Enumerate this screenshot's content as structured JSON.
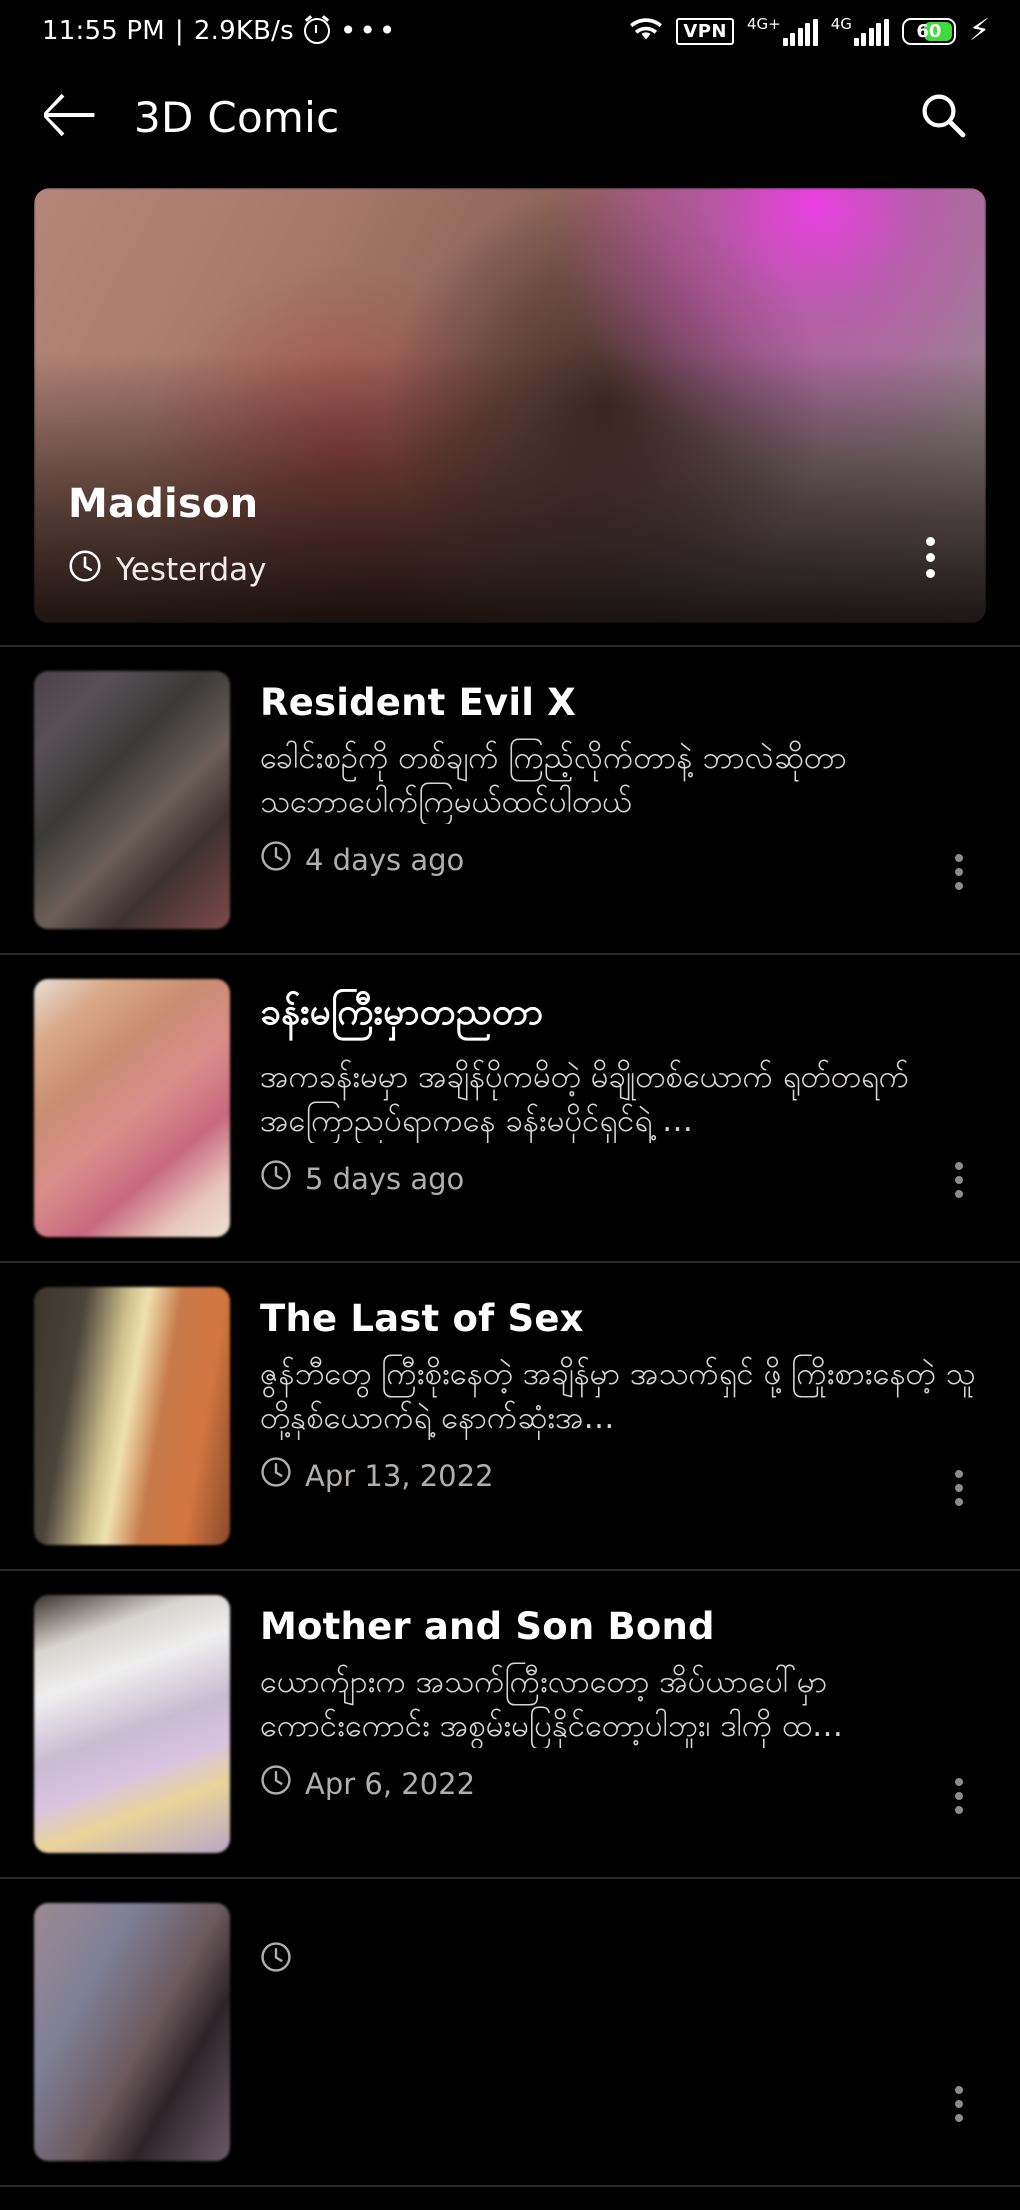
{
  "statusbar": {
    "time": "11:55 PM",
    "separator": "|",
    "netspeed": "2.9KB/s",
    "alarm_icon": "alarm-clock-icon",
    "overflow_icon": "more-dots-icon",
    "wifi_icon": "wifi-icon",
    "vpn_label": "VPN",
    "sim1_label": "4G+",
    "sim2_label": "4G",
    "battery_percent": "60",
    "charging_icon": "lightning-bolt-icon",
    "battery_color": "#3ddc3d"
  },
  "appbar": {
    "back_icon": "back-arrow-icon",
    "title": "3D Comic",
    "search_icon": "search-icon"
  },
  "featured": {
    "title": "Madison",
    "date": "Yesterday",
    "clock_icon": "clock-icon",
    "more_icon": "overflow-menu-icon"
  },
  "list": [
    {
      "title": "Resident Evil X",
      "description": "ခေါင်းစဉ်ကို တစ်ချက် ကြည့်လိုက်တာနဲ့ ဘာလဲဆိုတာ သဘောပေါက်ကြမယ်ထင်ပါတယ်",
      "date": "4 days ago",
      "clock_icon": "clock-icon",
      "more_icon": "overflow-menu-icon",
      "thumb_gradient": "linear-gradient(135deg,#4a4248 0%,#575055 18%,#3a3a38 38%,#6b5f58 58%,#3d322e 74%,#7d4a4a 100%)"
    },
    {
      "title": "ခန်းမကြီးမှာတညတာ",
      "description": "အကခန်းမမှာ အချိန်ပိုကမိတဲ့ မိချိုတစ်ယောက် ရုတ်တရက် အကြောညပ်ရာကနေ ခန်းမပိုင်ရှင်ရဲ့ …",
      "date": "5 days ago",
      "clock_icon": "clock-icon",
      "more_icon": "overflow-menu-icon",
      "thumb_gradient": "linear-gradient(140deg,#e8ded6 0%,#d9a98a 16%,#c98d72 34%,#d98e8a 52%,#c9697f 70%,#e8c6bd 86%,#efe0d6 100%)"
    },
    {
      "title": "The Last of Sex",
      "description": "ဇွန်ဘီတွေ ကြီးစိုးနေတဲ့ အချိန်မှာ အသက်ရှင် ဖို့ ကြိုးစားနေတဲ့ သူတို့နှစ်ယောက်ရဲ့ နောက်ဆုံးအ…",
      "date": "Apr 13, 2022",
      "clock_icon": "clock-icon",
      "more_icon": "overflow-menu-icon",
      "thumb_gradient": "linear-gradient(100deg,#3a342e 0%,#4a443a 22%,#cfc08d 40%,#efe1b0 48%,#c87a4a 62%,#d2763f 80%,#8a4a2c 100%)"
    },
    {
      "title": "Mother and Son Bond",
      "description": "ယောက်ျားက အသက်ကြီးလာတော့ အိပ်ယာပေါ်မှာ ကောင်းကောင်း အစွမ်းမပြနိုင်တော့ပါဘူး၊ ဒါကို ထ…",
      "date": "Apr 6, 2022",
      "clock_icon": "clock-icon",
      "more_icon": "overflow-menu-icon",
      "thumb_gradient": "linear-gradient(160deg,#3a322e 0%,#d8d4d0 18%,#efefef 32%,#c8bcd0 52%,#d9c4e0 66%,#e8d49a 78%,#b9a7c6 100%)"
    },
    {
      "title": "",
      "description": "",
      "date": "",
      "clock_icon": "clock-icon",
      "more_icon": "overflow-menu-icon",
      "thumb_gradient": "linear-gradient(120deg,#9c8a93 0%,#7e7f95 30%,#6b5a5e 55%,#2e2428 72%,#6a5a68 100%)"
    }
  ]
}
